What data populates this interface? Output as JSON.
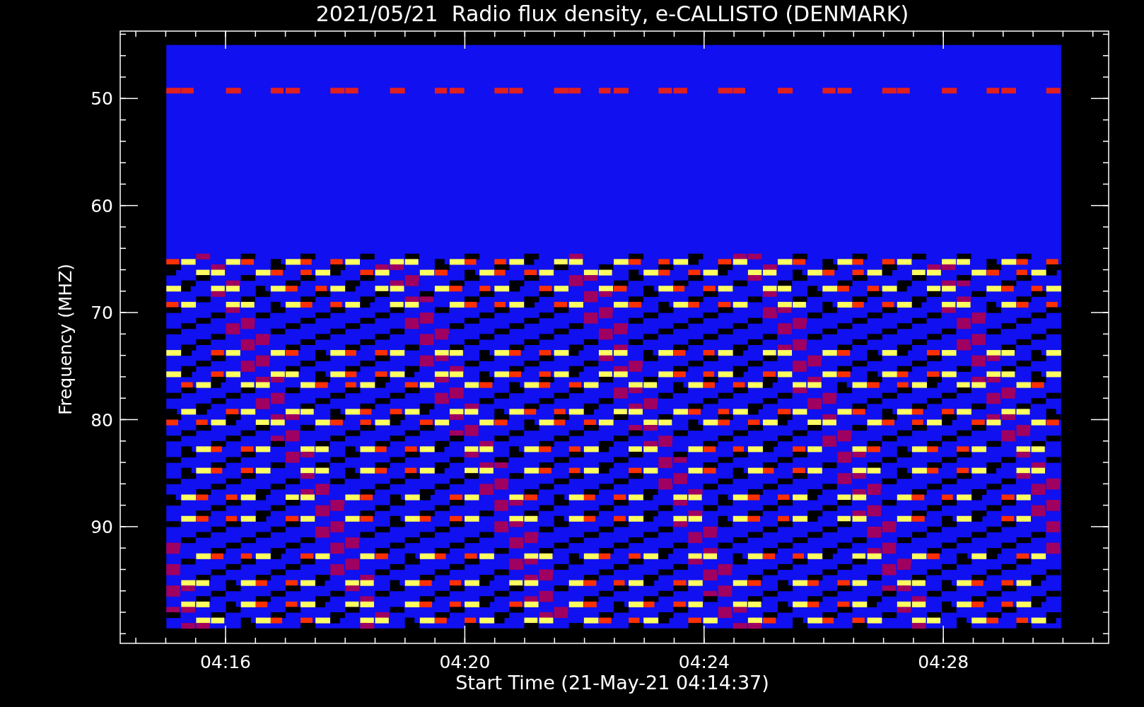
{
  "title": "2021/05/21  Radio flux density, e-CALLISTO (DENMARK)",
  "ylabel": "Frequency (MHZ)",
  "xlabel": "Start Time (21-May-21 04:14:37)",
  "yticks": [
    "50",
    "60",
    "70",
    "80",
    "90"
  ],
  "xticks": [
    "04:16",
    "04:20",
    "04:24",
    "04:28"
  ]
}
